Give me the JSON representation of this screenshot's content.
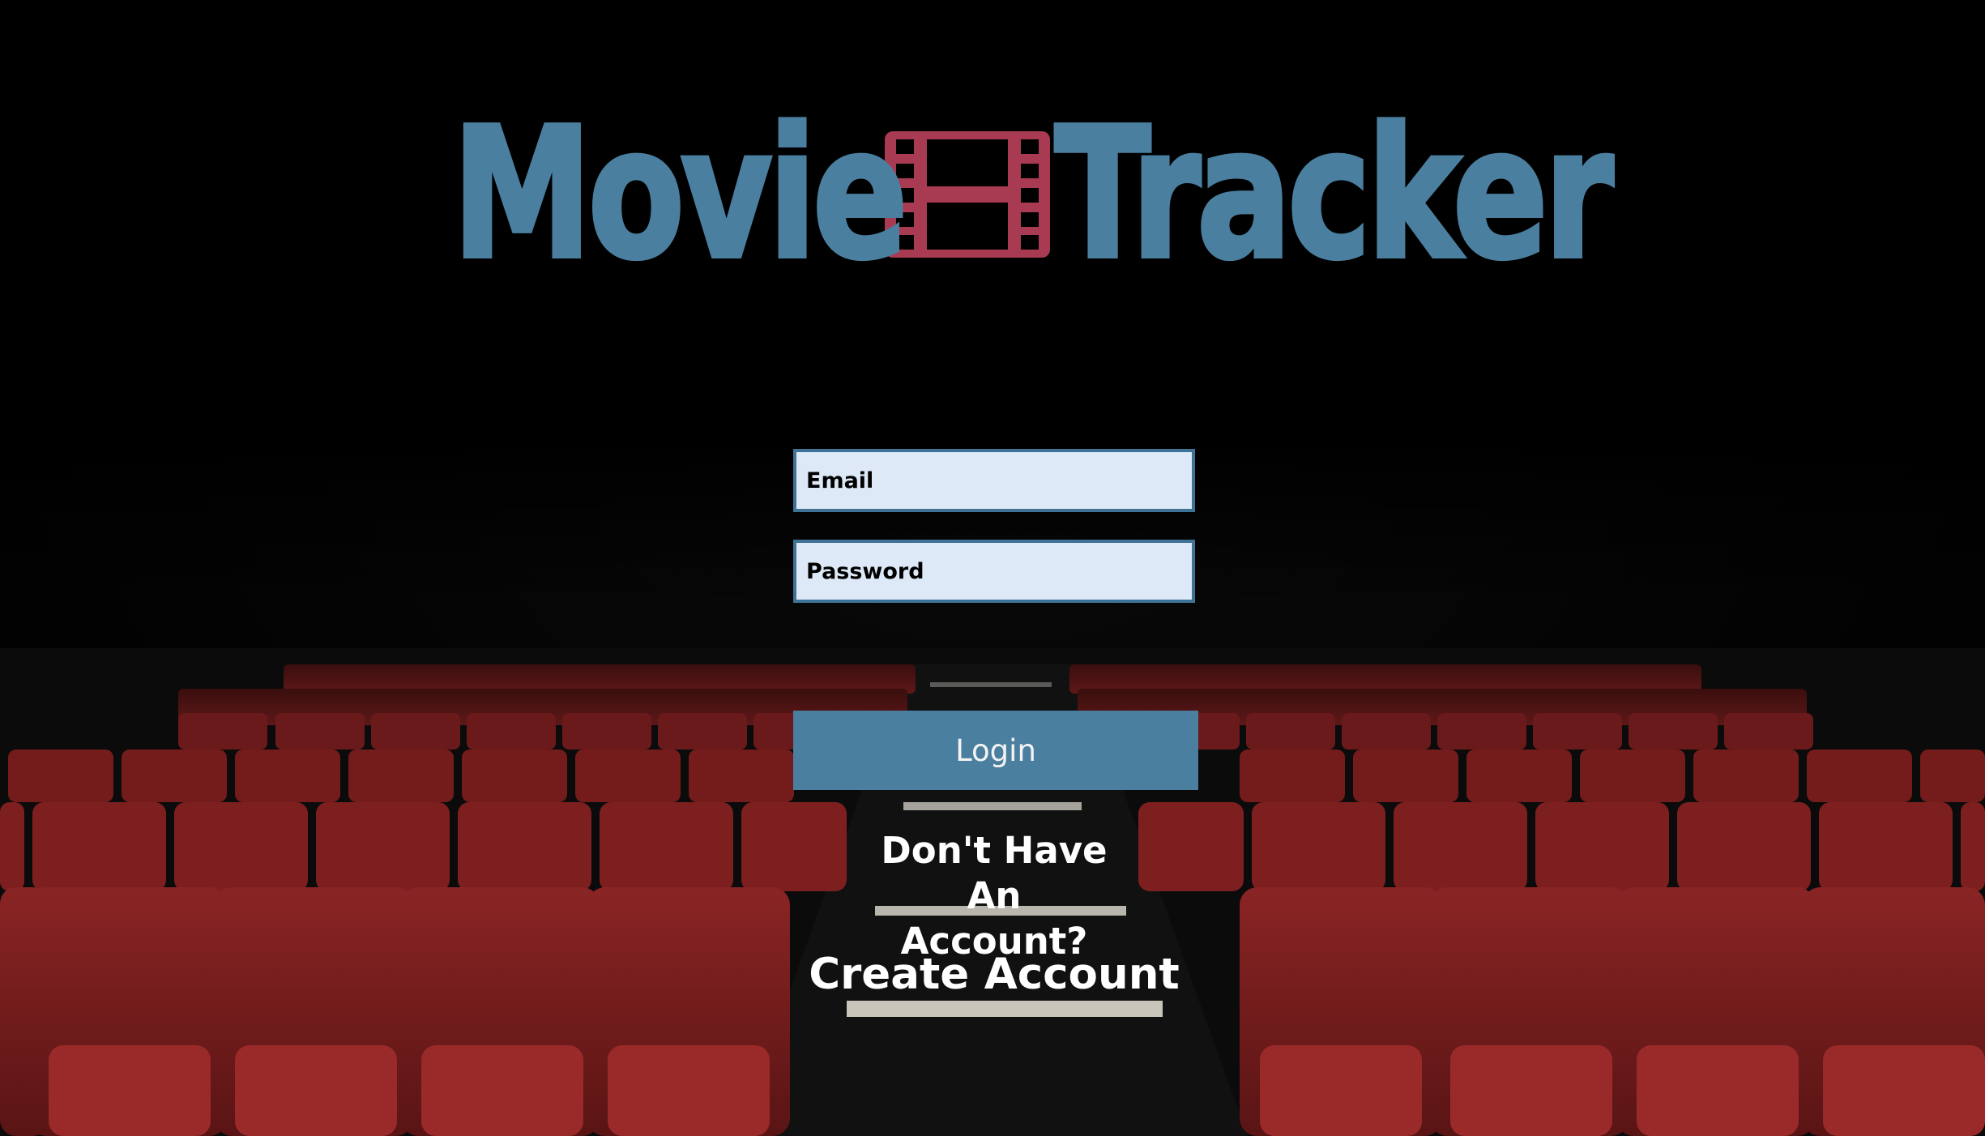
{
  "app": {
    "title_left": "Movie",
    "title_right": "Tracker",
    "title_icon": "film-strip-icon"
  },
  "form": {
    "email_placeholder": "Email",
    "password_placeholder": "Password",
    "login_label": "Login"
  },
  "signup": {
    "prompt": "Don't Have An Account?",
    "link_label": "Create Account"
  },
  "colors": {
    "brand_blue": "#4a7fa0",
    "icon_red": "#a83b52",
    "field_bg": "#dde9f6",
    "seat_red": "#7a1c1c"
  },
  "background": {
    "description_icon": "theater-seats-background"
  }
}
